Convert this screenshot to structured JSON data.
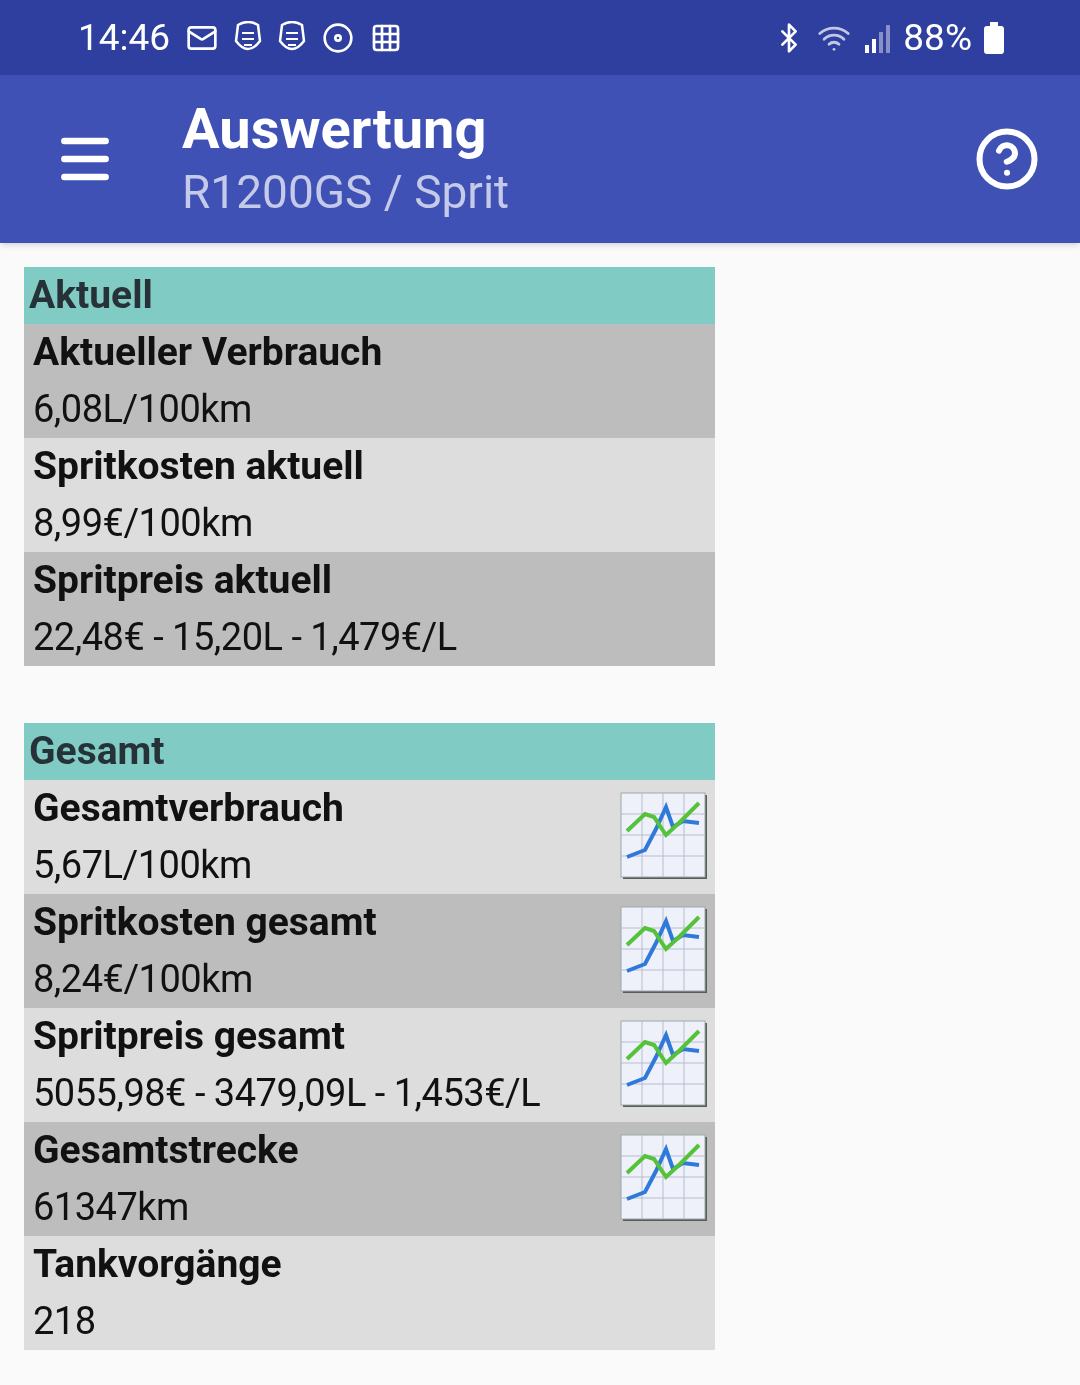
{
  "status_bar": {
    "time": "14:46",
    "battery": "88%"
  },
  "app_bar": {
    "title": "Auswertung",
    "subtitle": "R1200GS / Sprit"
  },
  "sections": [
    {
      "title": "Aktuell",
      "rows": [
        {
          "label": "Aktueller Verbrauch",
          "value": "6,08L/100km",
          "chart": false
        },
        {
          "label": "Spritkosten aktuell",
          "value": "8,99€/100km",
          "chart": false
        },
        {
          "label": "Spritpreis aktuell",
          "value": "22,48€ - 15,20L - 1,479€/L",
          "chart": false
        }
      ]
    },
    {
      "title": "Gesamt",
      "rows": [
        {
          "label": "Gesamtverbrauch",
          "value": "5,67L/100km",
          "chart": true
        },
        {
          "label": "Spritkosten gesamt",
          "value": "8,24€/100km",
          "chart": true
        },
        {
          "label": "Spritpreis gesamt",
          "value": "5055,98€ - 3479,09L - 1,453€/L",
          "chart": true
        },
        {
          "label": "Gesamtstrecke",
          "value": "61347km",
          "chart": true
        },
        {
          "label": "Tankvorgänge",
          "value": "218",
          "chart": false
        }
      ]
    }
  ]
}
